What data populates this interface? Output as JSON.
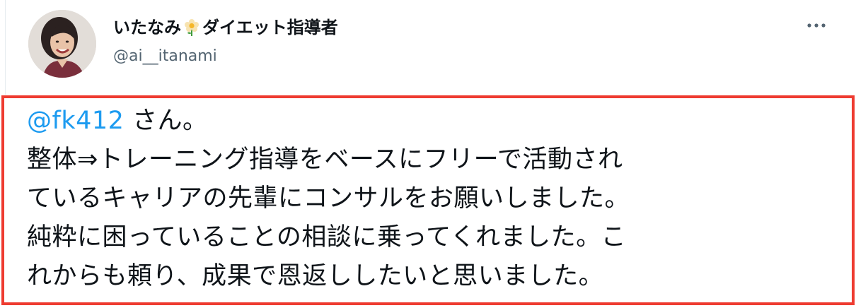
{
  "author": {
    "name_prefix": "いたなみ",
    "name_suffix": "ダイエット指導者",
    "handle": "@ai__itanami",
    "emoji_icon": "blossom-flower-icon"
  },
  "tweet": {
    "mention": "@fk412",
    "line1_rest": " さん。",
    "line2": "整体⇒トレーニング指導をベースにフリーで活動され",
    "line3": "ているキャリアの先輩にコンサルをお願いしました。",
    "line4": "純粋に困っていることの相談に乗ってくれました。こ",
    "line5": "れからも頼り、成果で恩返ししたいと思いました。"
  },
  "colors": {
    "mention": "#1d9bf0",
    "highlight_border": "#ee3b30",
    "handle": "#536471",
    "text": "#0f1419"
  },
  "icons": {
    "more": "more-horizontal-icon"
  }
}
